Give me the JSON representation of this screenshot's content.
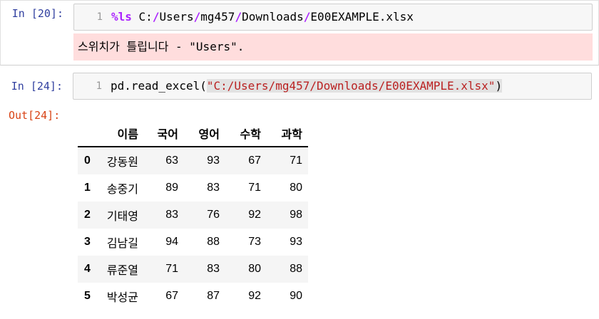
{
  "cells": [
    {
      "prompt": "In [20]:",
      "line_number": "1",
      "code": {
        "magic": "%ls",
        "path_parts": [
          "C:",
          "/",
          "Users",
          "/",
          "mg457",
          "/",
          "Downloads",
          "/",
          "E00EXAMPLE.xlsx"
        ]
      },
      "error_text": "스위치가 틀립니다 - \"Users\"."
    },
    {
      "prompt": "In [24]:",
      "line_number": "1",
      "code": {
        "func": "pd.read_excel(",
        "string": "\"C:/Users/mg457/Downloads/E00EXAMPLE.xlsx\"",
        "close": ")"
      },
      "output_prompt": "Out[24]:",
      "dataframe": {
        "columns": [
          "이름",
          "국어",
          "영어",
          "수학",
          "과학"
        ],
        "rows": [
          {
            "index": "0",
            "values": [
              "강동원",
              "63",
              "93",
              "67",
              "71"
            ]
          },
          {
            "index": "1",
            "values": [
              "송중기",
              "89",
              "83",
              "71",
              "80"
            ]
          },
          {
            "index": "2",
            "values": [
              "기태영",
              "83",
              "76",
              "92",
              "98"
            ]
          },
          {
            "index": "3",
            "values": [
              "김남길",
              "94",
              "88",
              "73",
              "93"
            ]
          },
          {
            "index": "4",
            "values": [
              "류준열",
              "71",
              "83",
              "80",
              "88"
            ]
          },
          {
            "index": "5",
            "values": [
              "박성균",
              "67",
              "87",
              "92",
              "90"
            ]
          }
        ]
      }
    }
  ]
}
